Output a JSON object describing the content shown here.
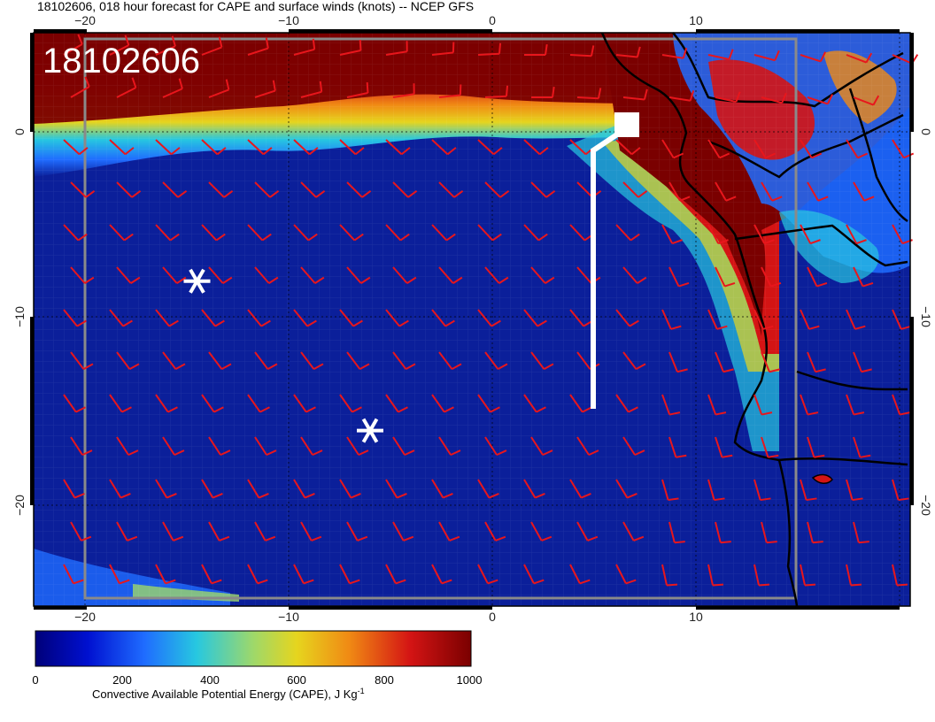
{
  "title": "18102606, 018 hour forecast for CAPE and surface winds (knots) -- NCEP GFS",
  "stamp": "18102606",
  "axes": {
    "lon_ticks": [
      "−20",
      "−10",
      "0",
      "10"
    ],
    "lat_ticks": [
      "0",
      "−10",
      "−20"
    ]
  },
  "colorbar": {
    "ticks": [
      "0",
      "200",
      "400",
      "600",
      "800",
      "1000"
    ],
    "label_main": "Convective Available Potential Energy (CAPE), J Kg",
    "label_sup": "-1",
    "colors": [
      "#00007a",
      "#0010d0",
      "#1f6cff",
      "#27c8e0",
      "#9ed86a",
      "#e6d51e",
      "#f08a14",
      "#d41414",
      "#7a0000"
    ]
  },
  "colors": {
    "ocean": "#0b1f9a",
    "land_high": "#7a0000",
    "barb": "#e8161c",
    "coast": "#000000",
    "track": "#ffffff",
    "frame": "#808080"
  },
  "markers": [
    {
      "name": "asterisk-marker-1",
      "lon": -14.5,
      "lat": -8
    },
    {
      "name": "asterisk-marker-2",
      "lon": -6,
      "lat": -16
    }
  ]
}
